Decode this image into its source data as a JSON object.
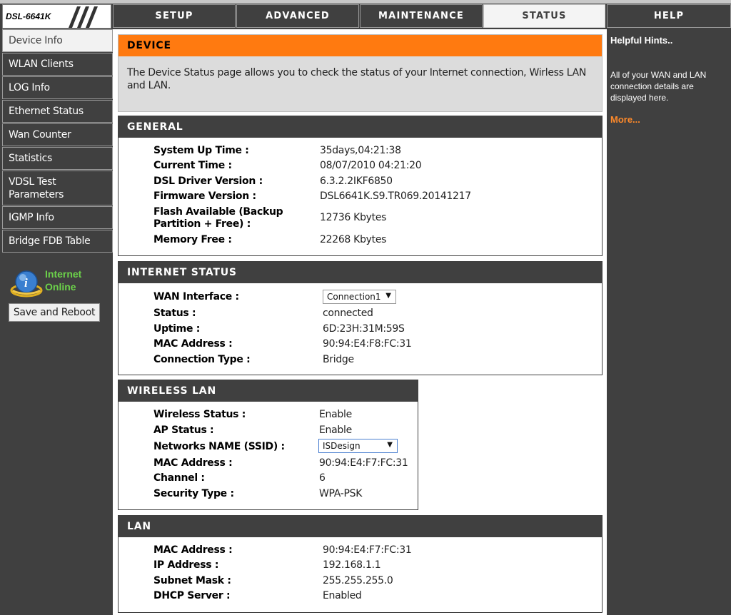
{
  "header": {
    "model": "DSL-6641K",
    "tabs": [
      {
        "label": "SETUP"
      },
      {
        "label": "ADVANCED"
      },
      {
        "label": "MAINTENANCE"
      },
      {
        "label": "STATUS"
      },
      {
        "label": "HELP"
      }
    ]
  },
  "sidebar": {
    "items": [
      {
        "label": "Device Info"
      },
      {
        "label": "WLAN Clients"
      },
      {
        "label": "LOG Info"
      },
      {
        "label": "Ethernet Status"
      },
      {
        "label": "Wan Counter"
      },
      {
        "label": "Statistics"
      },
      {
        "label": "VDSL Test Parameters"
      },
      {
        "label": "IGMP Info"
      },
      {
        "label": "Bridge FDB Table"
      }
    ],
    "status_line1": "Internet",
    "status_line2": "Online",
    "save_label": "Save and Reboot"
  },
  "device": {
    "heading": "DEVICE",
    "description": "The Device Status page allows you to check the status of your Internet connection, Wirless LAN and LAN."
  },
  "general": {
    "heading": "GENERAL",
    "rows": [
      {
        "label": "System Up Time :",
        "value": "35days,04:21:38"
      },
      {
        "label": "Current Time :",
        "value": "08/07/2010 04:21:20"
      },
      {
        "label": "DSL Driver Version :",
        "value": "6.3.2.2IKF6850"
      },
      {
        "label": "Firmware Version :",
        "value": "DSL6641K.S9.TR069.20141217"
      },
      {
        "label": "Flash Available (Backup Partition + Free) :",
        "value": "12736 Kbytes"
      },
      {
        "label": "Memory Free :",
        "value": "22268 Kbytes"
      }
    ]
  },
  "internet": {
    "heading": "INTERNET STATUS",
    "wan_label": "WAN Interface :",
    "wan_selected": "Connection1",
    "rows": [
      {
        "label": "Status :",
        "value": "connected"
      },
      {
        "label": "Uptime :",
        "value": "6D:23H:31M:59S"
      },
      {
        "label": "MAC Address :",
        "value": "90:94:E4:F8:FC:31"
      },
      {
        "label": "Connection Type :",
        "value": "Bridge"
      }
    ]
  },
  "wireless": {
    "heading": "WIRELESS LAN",
    "rows_top": [
      {
        "label": "Wireless Status :",
        "value": "Enable"
      },
      {
        "label": "AP Status :",
        "value": "Enable"
      }
    ],
    "ssid_label": "Networks NAME (SSID) :",
    "ssid_selected": "ISDesign",
    "rows_bottom": [
      {
        "label": "MAC Address :",
        "value": "90:94:E4:F7:FC:31"
      },
      {
        "label": "Channel :",
        "value": "6"
      },
      {
        "label": "Security Type :",
        "value": "WPA-PSK"
      }
    ]
  },
  "lan": {
    "heading": "LAN",
    "rows": [
      {
        "label": "MAC Address :",
        "value": "90:94:E4:F7:FC:31"
      },
      {
        "label": "IP Address :",
        "value": "192.168.1.1"
      },
      {
        "label": "Subnet Mask :",
        "value": "255.255.255.0"
      },
      {
        "label": "DHCP Server :",
        "value": "Enabled"
      }
    ]
  },
  "help": {
    "title": "Helpful Hints..",
    "text": "All of your WAN and LAN connection details are displayed here.",
    "more": "More..."
  },
  "colors": {
    "accent": "#ff7a10",
    "dark": "#404040",
    "online": "#6cd24a",
    "more_link": "#ff8a2a"
  }
}
